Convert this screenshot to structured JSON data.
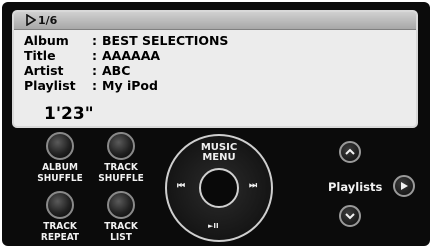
{
  "display": {
    "track_counter": "1/6",
    "play_icon": "play-triangle-icon",
    "rows": [
      {
        "label": "Album",
        "value": "BEST SELECTIONS"
      },
      {
        "label": "Title",
        "value": "AAAAAA"
      },
      {
        "label": "Artist",
        "value": "ABC"
      },
      {
        "label": "Playlist",
        "value": "My iPod"
      }
    ],
    "colon": ":",
    "elapsed": "1'23\""
  },
  "buttons": {
    "album_shuffle": [
      "ALBUM",
      "SHUFFLE"
    ],
    "track_shuffle": [
      "TRACK",
      "SHUFFLE"
    ],
    "track_repeat": [
      "TRACK",
      "REPEAT"
    ],
    "track_list": [
      "TRACK",
      "LIST"
    ]
  },
  "wheel": {
    "menu_label": [
      "MUSIC",
      "MENU"
    ],
    "prev_glyph": "⏮",
    "next_glyph": "⏭",
    "play_pause_glyph": "►II"
  },
  "playlists": {
    "label": "Playlists",
    "up_icon": "up-arrow-icon",
    "down_icon": "down-arrow-icon",
    "next_icon": "right-arrow-icon"
  },
  "colors": {
    "panel": "#0b0b0b",
    "display_bg": "#ececec",
    "text_light": "#f2f2f2"
  }
}
